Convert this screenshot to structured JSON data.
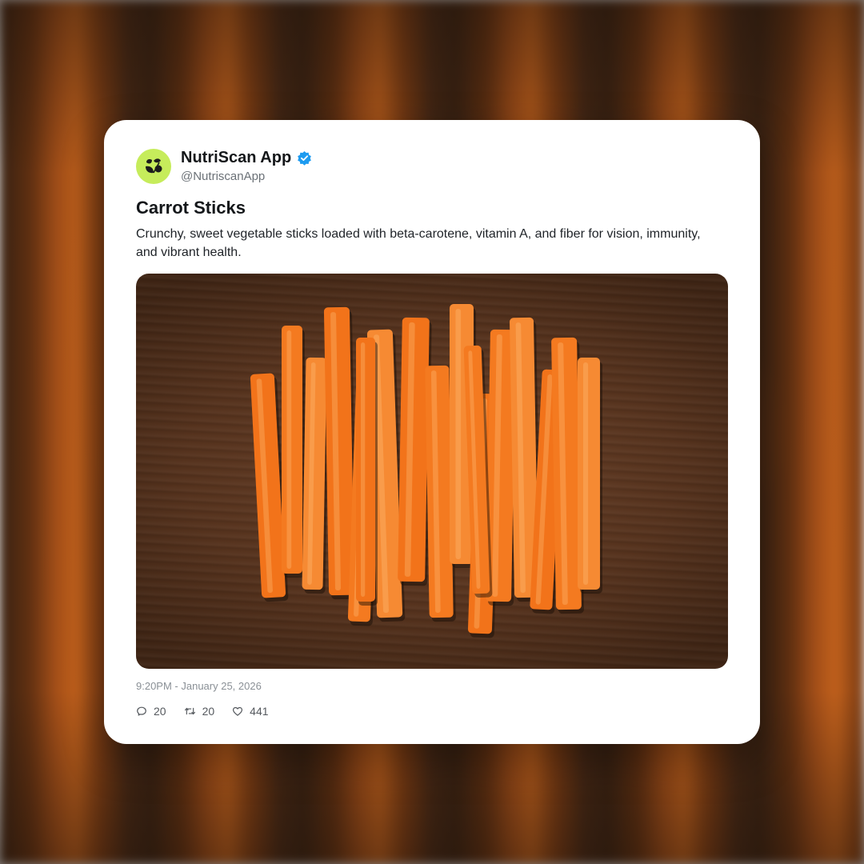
{
  "post": {
    "author_name": "NutriScan App",
    "author_handle": "@NutriscanApp",
    "verified": true,
    "avatar_icon": "plant-leaf-logo-icon",
    "title": "Carrot Sticks",
    "description": "Crunchy, sweet vegetable sticks loaded with beta-carotene, vitamin A, and fiber for vision, immunity, and vibrant health.",
    "image_subject": "carrot-sticks-on-wooden-board",
    "timestamp": "9:20PM - January 25, 2026",
    "stats": {
      "replies": "20",
      "reposts": "20",
      "likes": "441"
    }
  },
  "colors": {
    "avatar_bg": "#c6ec5b",
    "verified_badge": "#1d9bf0",
    "card_bg": "#ffffff",
    "carrot": "#f47a20"
  }
}
